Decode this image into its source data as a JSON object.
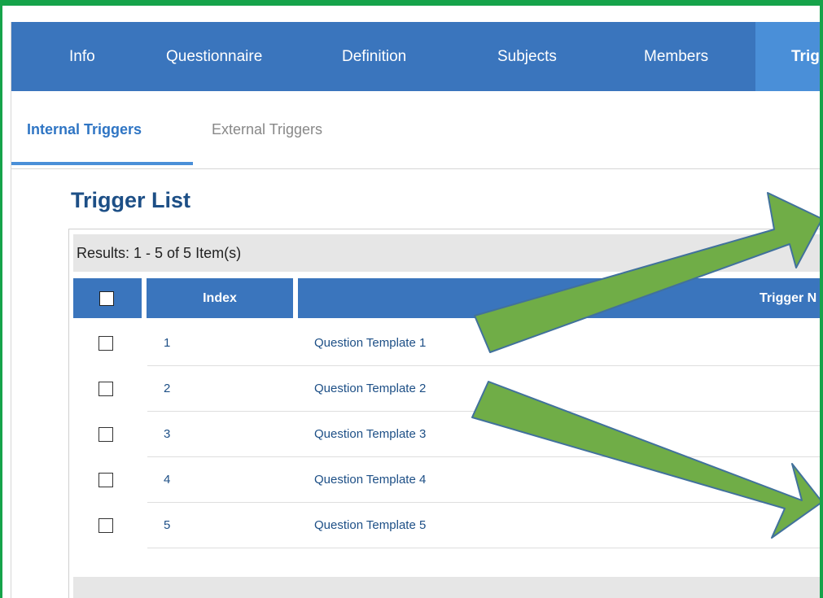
{
  "main_nav": {
    "tabs": [
      {
        "label": "Info"
      },
      {
        "label": "Questionnaire"
      },
      {
        "label": "Definition"
      },
      {
        "label": "Subjects"
      },
      {
        "label": "Members"
      },
      {
        "label": "Trig"
      }
    ]
  },
  "sub_nav": {
    "tabs": [
      {
        "label": "Internal Triggers"
      },
      {
        "label": "External Triggers"
      }
    ]
  },
  "page": {
    "title": "Trigger List"
  },
  "table": {
    "results_text": "Results: 1 - 5 of 5 Item(s)",
    "columns": {
      "index": "Index",
      "trigger_name": "Trigger N"
    },
    "rows": [
      {
        "index": "1",
        "name": "Question Template 1"
      },
      {
        "index": "2",
        "name": "Question Template 2"
      },
      {
        "index": "3",
        "name": "Question Template 3"
      },
      {
        "index": "4",
        "name": "Question Template 4"
      },
      {
        "index": "5",
        "name": "Question Template 5"
      }
    ]
  },
  "colors": {
    "frame_border": "#16a34a",
    "nav_blue": "#3a75bd",
    "active_blue": "#4a8fd8",
    "arrow_fill": "#70ad47",
    "arrow_stroke": "#41719c"
  }
}
